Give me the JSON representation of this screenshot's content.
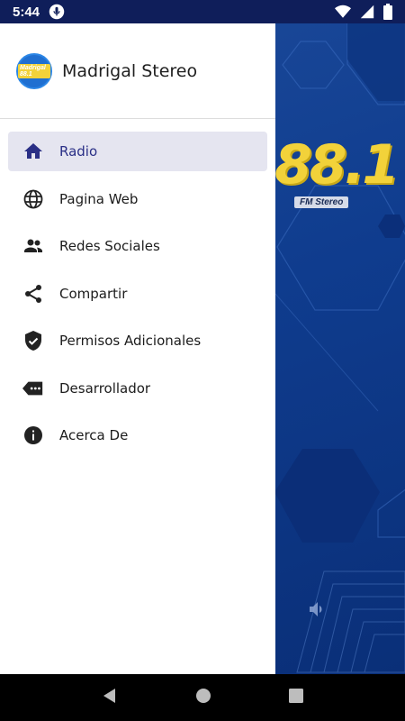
{
  "status_bar": {
    "time": "5:44",
    "icons": [
      "mic-icon",
      "wifi-icon",
      "signal-icon",
      "battery-icon"
    ]
  },
  "drawer": {
    "app_title": "Madrigal Stereo",
    "logo_text": "Madrigal 88.1",
    "items": [
      {
        "label": "Radio",
        "icon": "home-icon",
        "active": true
      },
      {
        "label": "Pagina Web",
        "icon": "globe-icon",
        "active": false
      },
      {
        "label": "Redes Sociales",
        "icon": "people-icon",
        "active": false
      },
      {
        "label": "Compartir",
        "icon": "share-icon",
        "active": false
      },
      {
        "label": "Permisos Adicionales",
        "icon": "shield-check-icon",
        "active": false
      },
      {
        "label": "Desarrollador",
        "icon": "tag-dots-icon",
        "active": false
      },
      {
        "label": "Acerca De",
        "icon": "info-icon",
        "active": false
      }
    ]
  },
  "background": {
    "logo_number": "88.1",
    "logo_sub": "FM Stereo"
  },
  "colors": {
    "accent": "#2a2f86",
    "active_bg": "#e5e5f0",
    "background_blue": "#0f3c8e",
    "status_bar": "#0f1e5a"
  }
}
